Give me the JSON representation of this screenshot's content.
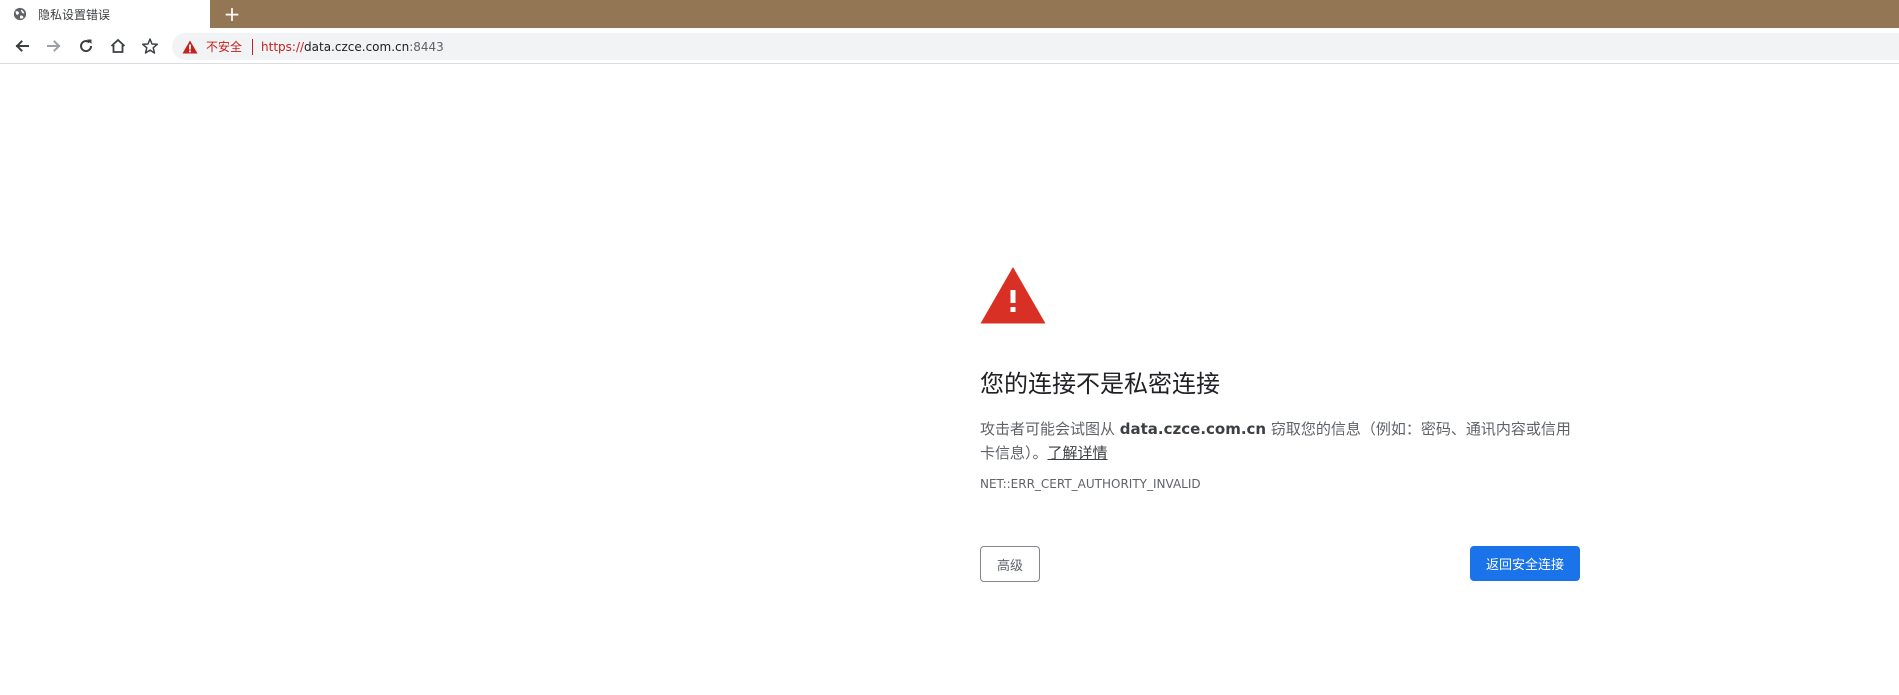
{
  "tab": {
    "title": "隐私设置错误",
    "icon": "globe-icon",
    "new_tab_label": "+"
  },
  "toolbar": {
    "back_icon": "back-arrow-icon",
    "forward_icon": "forward-arrow-icon",
    "reload_icon": "reload-icon",
    "home_icon": "home-icon",
    "bookmark_icon": "star-icon"
  },
  "omnibox": {
    "security_icon": "warning-triangle-icon",
    "security_label": "不安全",
    "url_scheme": "https://",
    "url_host": "data.czce.com.cn",
    "url_port": ":8443"
  },
  "interstitial": {
    "icon": "warning-triangle-icon",
    "heading": "您的连接不是私密连接",
    "desc_prefix": "攻击者可能会试图从 ",
    "desc_host": "data.czce.com.cn",
    "desc_suffix": " 窃取您的信息（例如：密码、通讯内容或信用卡信息）。",
    "learn_more": "了解详情",
    "error_code": "NET::ERR_CERT_AUTHORITY_INVALID",
    "advanced_button": "高级",
    "back_button": "返回安全连接"
  },
  "colors": {
    "tabbar_bg": "#937754",
    "danger": "#d93025",
    "primary_button": "#1a73e8"
  }
}
